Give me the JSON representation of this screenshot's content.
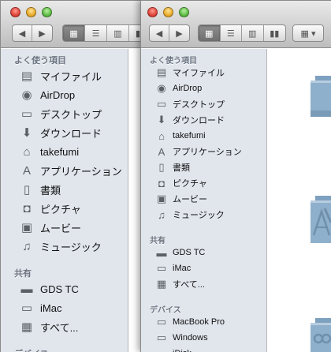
{
  "back_window": {
    "sidebar": {
      "favorites_heading": "よく使う項目",
      "favorites": [
        {
          "label": "マイファイル",
          "icon": "all-my-files-icon"
        },
        {
          "label": "AirDrop",
          "icon": "airdrop-icon"
        },
        {
          "label": "デスクトップ",
          "icon": "desktop-icon"
        },
        {
          "label": "ダウンロード",
          "icon": "downloads-icon"
        },
        {
          "label": "takefumi",
          "icon": "home-icon"
        },
        {
          "label": "アプリケーション",
          "icon": "applications-icon"
        },
        {
          "label": "書類",
          "icon": "documents-icon"
        },
        {
          "label": "ピクチャ",
          "icon": "pictures-icon"
        },
        {
          "label": "ムービー",
          "icon": "movies-icon"
        },
        {
          "label": "ミュージック",
          "icon": "music-icon"
        }
      ],
      "shared_heading": "共有",
      "shared": [
        {
          "label": "GDS TC",
          "icon": "server-icon"
        },
        {
          "label": "iMac",
          "icon": "imac-icon"
        },
        {
          "label": "すべて...",
          "icon": "network-icon"
        }
      ],
      "devices_heading": "デバイス"
    }
  },
  "front_window": {
    "sidebar": {
      "favorites_heading": "よく使う項目",
      "favorites": [
        {
          "label": "マイファイル",
          "icon": "all-my-files-icon"
        },
        {
          "label": "AirDrop",
          "icon": "airdrop-icon"
        },
        {
          "label": "デスクトップ",
          "icon": "desktop-icon"
        },
        {
          "label": "ダウンロード",
          "icon": "downloads-icon"
        },
        {
          "label": "takefumi",
          "icon": "home-icon"
        },
        {
          "label": "アプリケーション",
          "icon": "applications-icon"
        },
        {
          "label": "書類",
          "icon": "documents-icon"
        },
        {
          "label": "ピクチャ",
          "icon": "pictures-icon"
        },
        {
          "label": "ムービー",
          "icon": "movies-icon"
        },
        {
          "label": "ミュージック",
          "icon": "music-icon"
        }
      ],
      "shared_heading": "共有",
      "shared": [
        {
          "label": "GDS TC",
          "icon": "server-icon"
        },
        {
          "label": "iMac",
          "icon": "imac-icon"
        },
        {
          "label": "すべて...",
          "icon": "network-icon"
        }
      ],
      "devices_heading": "デバイス",
      "devices": [
        {
          "label": "MacBook Pro",
          "icon": "laptop-icon"
        },
        {
          "label": "Windows",
          "icon": "windows-pc-icon"
        },
        {
          "label": "iDisk",
          "icon": "idisk-icon"
        }
      ]
    },
    "content": {
      "folders": [
        {
          "icon": "generic-folder-icon"
        },
        {
          "icon": "applications-folder-icon"
        },
        {
          "icon": "utilities-folder-icon"
        }
      ]
    }
  },
  "colors": {
    "sidebar_bg": "#e1e6ed",
    "folder_blue": "#8fb0cc",
    "section_heading": "#6b7380"
  }
}
